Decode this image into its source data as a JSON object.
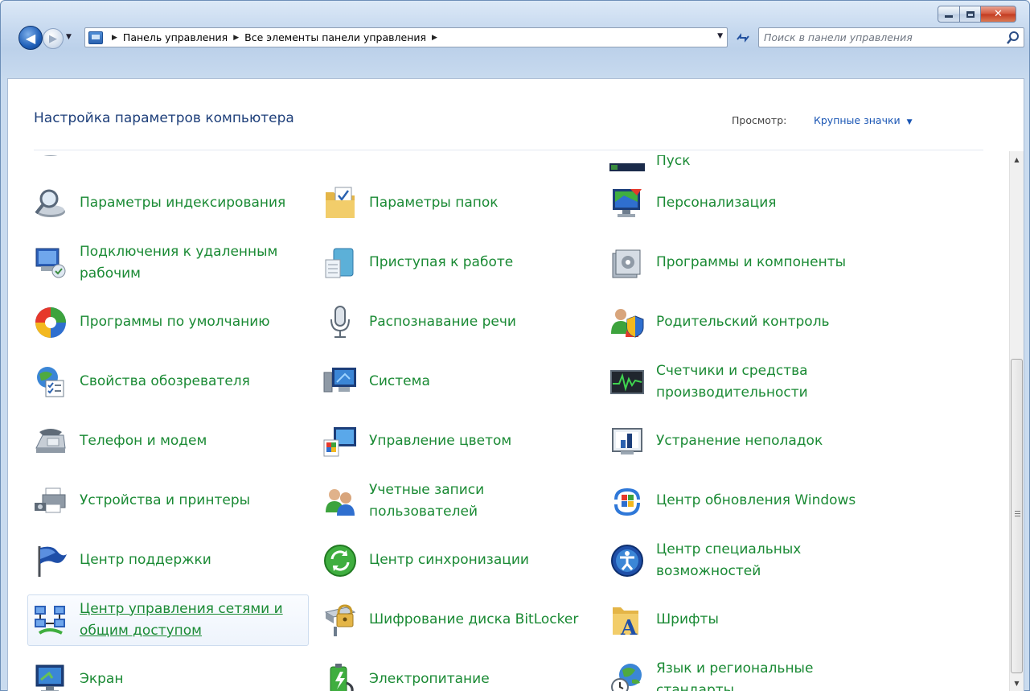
{
  "window": {
    "caption": {
      "minimize_icon": "minimize-icon",
      "maximize_icon": "maximize-icon",
      "close_icon": "close-icon",
      "close_glyph": "✕"
    }
  },
  "nav": {
    "back_glyph": "◀",
    "forward_glyph": "▶",
    "breadcrumbs": [
      "Панель управления",
      "Все элементы панели управления"
    ],
    "search_placeholder": "Поиск в панели управления"
  },
  "header": {
    "title": "Настройка параметров компьютера",
    "view_label": "Просмотр:",
    "view_value": "Крупные значки"
  },
  "items": {
    "partial": [
      {
        "label": "",
        "icon": "generic-icon"
      },
      {
        "label": "",
        "icon": "generic-icon"
      },
      {
        "label": "Пуск",
        "icon": "taskbar-icon"
      }
    ],
    "col1": [
      {
        "label": "Параметры индексирования",
        "icon": "indexing-icon"
      },
      {
        "label": "Подключения к удаленным рабочим",
        "icon": "remote-desktop-icon"
      },
      {
        "label": "Программы по умолчанию",
        "icon": "default-programs-icon"
      },
      {
        "label": "Свойства обозревателя",
        "icon": "internet-options-icon"
      },
      {
        "label": "Телефон и модем",
        "icon": "phone-modem-icon"
      },
      {
        "label": "Устройства и принтеры",
        "icon": "devices-printers-icon"
      },
      {
        "label": "Центр поддержки",
        "icon": "action-center-icon"
      },
      {
        "label": "Центр управления сетями и общим доступом",
        "icon": "network-center-icon"
      },
      {
        "label": "Экран",
        "icon": "display-icon"
      }
    ],
    "col2": [
      {
        "label": "Параметры папок",
        "icon": "folder-options-icon"
      },
      {
        "label": "Приступая к работе",
        "icon": "getting-started-icon"
      },
      {
        "label": "Распознавание речи",
        "icon": "microphone-icon"
      },
      {
        "label": "Система",
        "icon": "system-icon"
      },
      {
        "label": "Управление цветом",
        "icon": "color-management-icon"
      },
      {
        "label": "Учетные записи пользователей",
        "icon": "user-accounts-icon"
      },
      {
        "label": "Центр синхронизации",
        "icon": "sync-center-icon"
      },
      {
        "label": "Шифрование диска BitLocker",
        "icon": "bitlocker-icon"
      },
      {
        "label": "Электропитание",
        "icon": "power-options-icon"
      }
    ],
    "col3": [
      {
        "label": "Персонализация",
        "icon": "personalization-icon"
      },
      {
        "label": "Программы и компоненты",
        "icon": "programs-features-icon"
      },
      {
        "label": "Родительский контроль",
        "icon": "parental-controls-icon"
      },
      {
        "label": "Счетчики и средства производительности",
        "icon": "performance-icon"
      },
      {
        "label": "Устранение неполадок",
        "icon": "troubleshooting-icon"
      },
      {
        "label": "Центр обновления Windows",
        "icon": "windows-update-icon"
      },
      {
        "label": "Центр специальных возможностей",
        "icon": "ease-of-access-icon"
      },
      {
        "label": "Шрифты",
        "icon": "fonts-icon"
      },
      {
        "label": "Язык и региональные стандарты",
        "icon": "region-language-icon"
      }
    ]
  },
  "scrollbar": {
    "up_glyph": "▲",
    "down_glyph": "▼",
    "position": 0.78
  }
}
